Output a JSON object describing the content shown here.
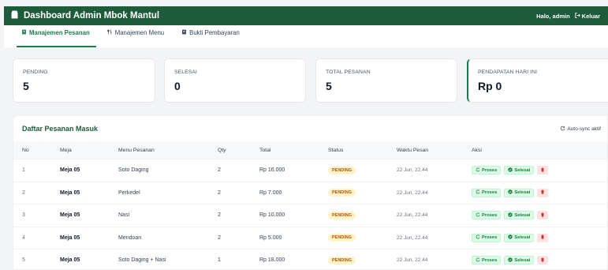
{
  "app": {
    "title": "Dashboard Admin Mbok Mantul",
    "greeting": "Halo, admin",
    "logout_label": "Keluar"
  },
  "tabs": [
    {
      "label": "Manajemen Pesanan",
      "icon": "receipt-icon",
      "active": true
    },
    {
      "label": "Manajemen Menu",
      "icon": "utensils-icon",
      "active": false
    },
    {
      "label": "Bukti Pembayaran",
      "icon": "document-icon",
      "active": false
    }
  ],
  "stats": [
    {
      "label": "PENDING",
      "value": "5"
    },
    {
      "label": "SELESAI",
      "value": "0"
    },
    {
      "label": "TOTAL PESANAN",
      "value": "5"
    },
    {
      "label": "PENDAPATAN HARI INI",
      "value": "Rp 0"
    }
  ],
  "orders": {
    "title": "Daftar Pesanan Masuk",
    "sync_label": "Auto-sync aktif",
    "columns": [
      "No",
      "Meja",
      "Menu Pesanan",
      "Qty",
      "Total",
      "Status",
      "Waktu Pesan",
      "Aksi"
    ],
    "actions": {
      "proses": "Proses",
      "selesai": "Selesai"
    },
    "rows": [
      {
        "no": "1",
        "meja": "Meja 05",
        "menu": "Soto Daging",
        "qty": "2",
        "total": "Rp 16.000",
        "status": "PENDING",
        "waktu": "22 Jun, 22.44"
      },
      {
        "no": "2",
        "meja": "Meja 05",
        "menu": "Perkedel",
        "qty": "2",
        "total": "Rp 7.000",
        "status": "PENDING",
        "waktu": "22 Jun, 22.44"
      },
      {
        "no": "3",
        "meja": "Meja 05",
        "menu": "Nasi",
        "qty": "2",
        "total": "Rp 10.000",
        "status": "PENDING",
        "waktu": "22 Jun, 22.44"
      },
      {
        "no": "4",
        "meja": "Meja 05",
        "menu": "Mendoan",
        "qty": "2",
        "total": "Rp 5.000",
        "status": "PENDING",
        "waktu": "22 Jun, 22.44"
      },
      {
        "no": "5",
        "meja": "Meja 05",
        "menu": "Soto Daging + Nasi",
        "qty": "1",
        "total": "Rp 18.000",
        "status": "PENDING",
        "waktu": "22 Jun, 22.44"
      }
    ]
  },
  "colors": {
    "brand": "#1e5b3d",
    "accent": "#1e7a4f",
    "pending_bg": "#fef3c7",
    "pending_text": "#b45309",
    "danger": "#dc2626"
  }
}
